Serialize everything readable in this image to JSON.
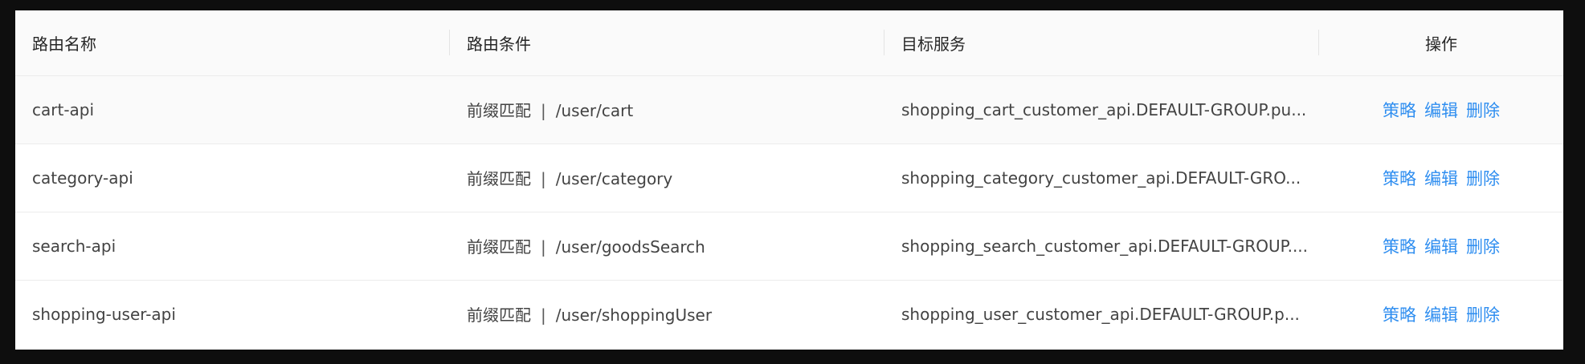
{
  "table": {
    "headers": {
      "name": "路由名称",
      "condition": "路由条件",
      "target": "目标服务",
      "actions": "操作"
    },
    "rows": [
      {
        "name": "cart-api",
        "match_type": "前缀匹配",
        "separator": "|",
        "path": "/user/cart",
        "target": "shopping_cart_customer_api.DEFAULT-GROUP.pu...",
        "actions": {
          "strategy": "策略",
          "edit": "编辑",
          "delete": "删除"
        }
      },
      {
        "name": "category-api",
        "match_type": "前缀匹配",
        "separator": "|",
        "path": "/user/category",
        "target": "shopping_category_customer_api.DEFAULT-GRO...",
        "actions": {
          "strategy": "策略",
          "edit": "编辑",
          "delete": "删除"
        }
      },
      {
        "name": "search-api",
        "match_type": "前缀匹配",
        "separator": "|",
        "path": "/user/goodsSearch",
        "target": "shopping_search_customer_api.DEFAULT-GROUP....",
        "actions": {
          "strategy": "策略",
          "edit": "编辑",
          "delete": "删除"
        }
      },
      {
        "name": "shopping-user-api",
        "match_type": "前缀匹配",
        "separator": "|",
        "path": "/user/shoppingUser",
        "target": "shopping_user_customer_api.DEFAULT-GROUP.p...",
        "actions": {
          "strategy": "策略",
          "edit": "编辑",
          "delete": "删除"
        }
      }
    ]
  },
  "colors": {
    "link": "#2f8ef0",
    "header_bg": "#fafafa",
    "page_bg": "#0e0e0e"
  }
}
